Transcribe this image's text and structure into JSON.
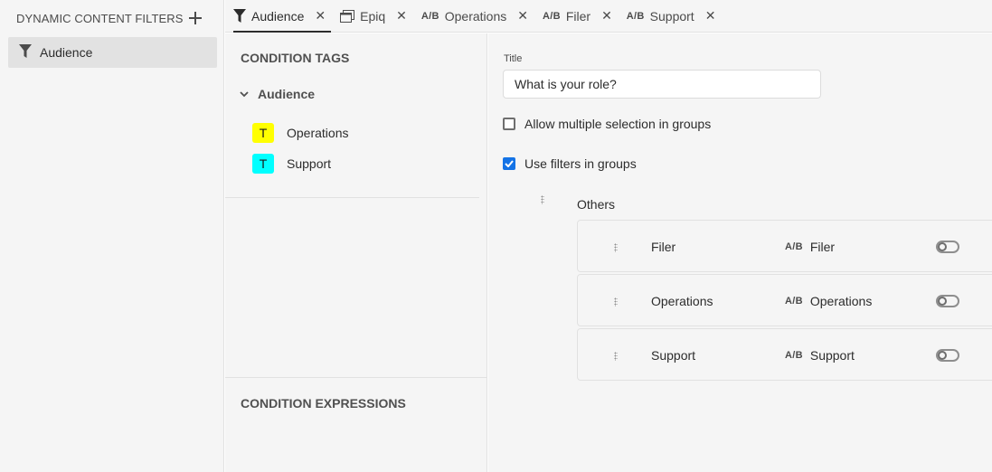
{
  "left_panel": {
    "title": "DYNAMIC CONTENT FILTERS",
    "items": [
      {
        "label": "Audience",
        "icon": "filter-icon"
      }
    ]
  },
  "tabs": [
    {
      "label": "Audience",
      "icon": "filter-icon",
      "active": true
    },
    {
      "label": "Epiq",
      "icon": "window-icon",
      "active": false
    },
    {
      "label": "Operations",
      "icon": "ab-icon",
      "active": false
    },
    {
      "label": "Filer",
      "icon": "ab-icon",
      "active": false
    },
    {
      "label": "Support",
      "icon": "ab-icon",
      "active": false
    }
  ],
  "ab_text": "A/B",
  "middle_panel": {
    "condition_tags_title": "CONDITION TAGS",
    "tree_group": "Audience",
    "tags": [
      {
        "badge": "T",
        "label": "Operations",
        "color": "#ffff00"
      },
      {
        "badge": "T",
        "label": "Support",
        "color": "#00ffff"
      }
    ],
    "condition_expressions_title": "CONDITION EXPRESSIONS"
  },
  "right_panel": {
    "title_label": "Title",
    "title_value": "What is your role?",
    "allow_multiple_label": "Allow multiple selection in groups",
    "allow_multiple_checked": false,
    "use_filters_label": "Use filters in groups",
    "use_filters_checked": true,
    "group_name": "Others",
    "group_items": [
      {
        "name": "Filer",
        "filter": "Filer",
        "enabled": false
      },
      {
        "name": "Operations",
        "filter": "Operations",
        "enabled": false
      },
      {
        "name": "Support",
        "filter": "Support",
        "enabled": false
      }
    ]
  },
  "colors": {
    "accent": "#1473e6",
    "tag_yellow": "#ffff00",
    "tag_cyan": "#00ffff"
  }
}
